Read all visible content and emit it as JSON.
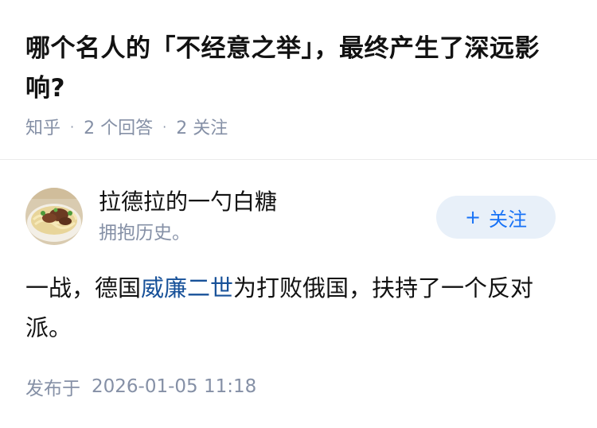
{
  "question": {
    "title": "哪个名人的「不经意之举」，最终产生了深远影响?",
    "source": "知乎",
    "answers_count": "2 个回答",
    "followers_count": "2 关注"
  },
  "author": {
    "name": "拉德拉的一勺白糖",
    "bio": "拥抱历史。",
    "avatar_icon": "noodle-bowl-avatar",
    "follow_label": "关注",
    "follow_icon": "plus-icon"
  },
  "answer": {
    "text_before": "一战，德国",
    "link_text": "威廉二世",
    "text_after": "为打败俄国，扶持了一个反对派。"
  },
  "footer": {
    "published_label": "发布于",
    "published_time": "2026-01-05 11:18"
  },
  "colors": {
    "text_primary": "#121212",
    "text_secondary": "#8590a6",
    "link": "#175199",
    "brand_blue": "#1772f6",
    "follow_bg": "#e8f0f9"
  }
}
